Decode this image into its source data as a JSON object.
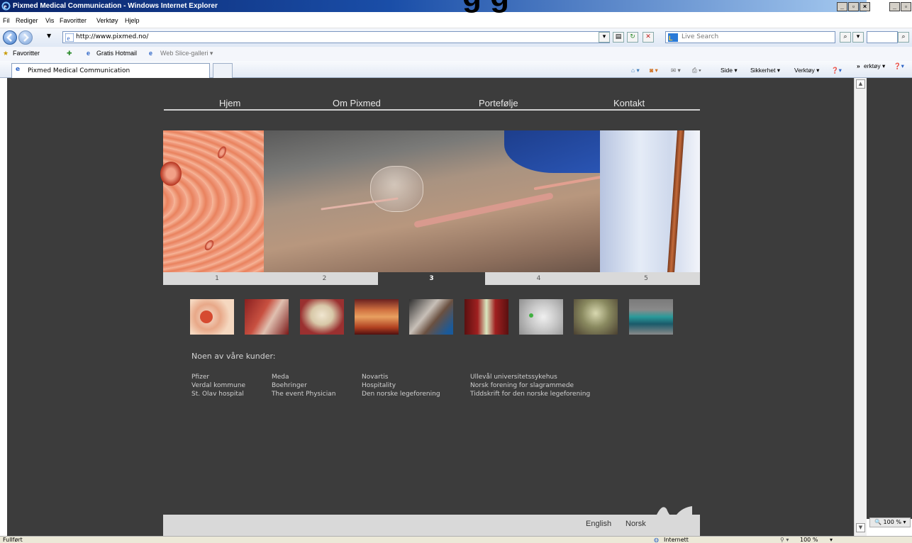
{
  "window": {
    "title": "Pixmed Medical Communication - Windows Internet Explorer",
    "overlay_title": "g      g",
    "min_label": "_",
    "max_label": "▫",
    "close_label": "×"
  },
  "menu": [
    "Fil",
    "Rediger",
    "Vis",
    "Favoritter",
    "Verktøy",
    "Hjelp"
  ],
  "address": {
    "url": "http://www.pixmed.no/",
    "search_placeholder": "Live Search"
  },
  "favorites": {
    "label": "Favoritter",
    "items": [
      "Gratis Hotmail",
      "Web Slice-galleri ▾"
    ]
  },
  "tab": {
    "title": "Pixmed Medical Communication"
  },
  "commandbar": {
    "side": "Side ▾",
    "sikkerhet": "Sikkerhet ▾",
    "verktoy": "Verktøy ▾",
    "overflow": "»",
    "verktoy2": "erktøy ▾"
  },
  "site": {
    "nav": [
      "Hjem",
      "Om Pixmed",
      "Portefølje",
      "Kontakt"
    ],
    "slides": [
      "1",
      "2",
      "3",
      "4",
      "5"
    ],
    "active_slide": 3,
    "clients_title": "Noen av våre kunder:",
    "clients": [
      [
        "Pfizer",
        "Verdal kommune",
        "St. Olav hospital"
      ],
      [
        "Meda",
        "Boehringer",
        "The event Physician"
      ],
      [
        "Novartis",
        "Hospitality",
        "Den norske legeforening"
      ],
      [
        "Ullevål universitetssykehus",
        "Norsk forening for slagrammede",
        "Tiddskrift for den norske legeforening"
      ]
    ],
    "languages": [
      "English",
      "Norsk"
    ]
  },
  "status": {
    "text": "Fullført",
    "zone": "Internett",
    "zoom": "100 %",
    "panel_zoom": "100 %"
  },
  "colors": {
    "page_bg": "#3c3c3c",
    "tab_bg": "#d9d9d9",
    "title_blue": "#0a246a"
  }
}
